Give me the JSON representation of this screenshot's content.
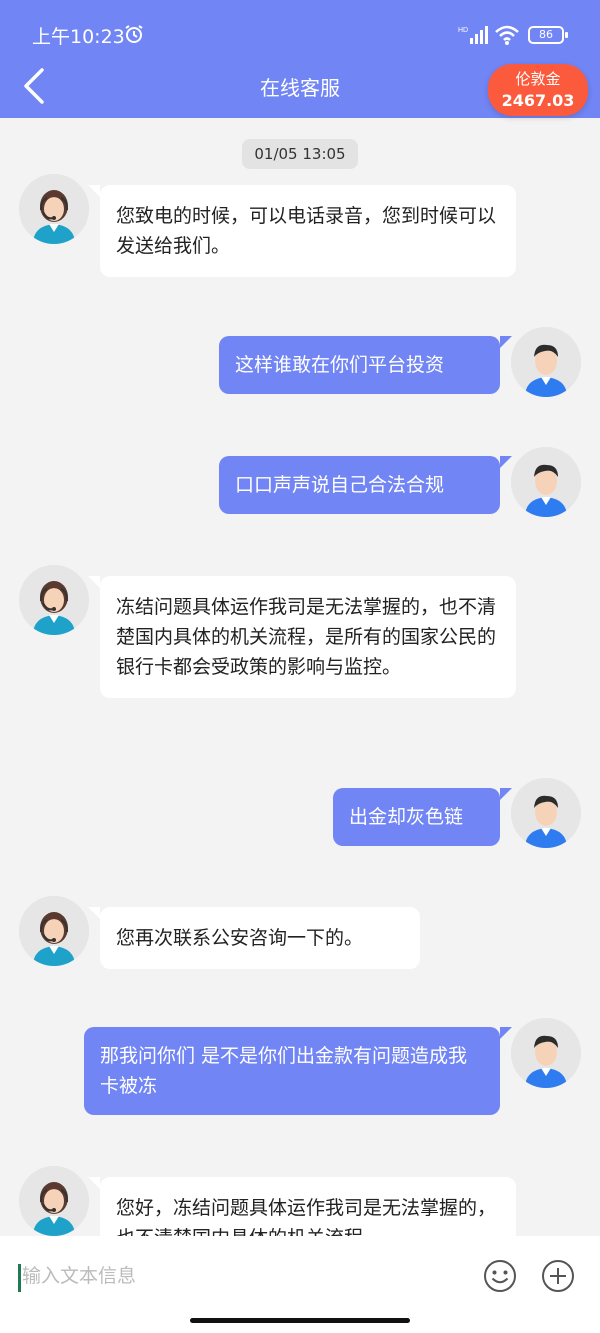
{
  "status_bar": {
    "time": "上午10:23",
    "battery": "86"
  },
  "header": {
    "title": "在线客服",
    "balance_label": "伦敦金",
    "balance_value": "2467.03"
  },
  "timestamp": "01/05 13:05",
  "messages": [
    {
      "side": "in",
      "text": "您致电的时候，可以电话录音，您到时候可以发送给我们。"
    },
    {
      "side": "out",
      "text": "这样谁敢在你们平台投资"
    },
    {
      "side": "out",
      "text": "口口声声说自己合法合规"
    },
    {
      "side": "in",
      "text": "冻结问题具体运作我司是无法掌握的，也不清楚国内具体的机关流程，是所有的国家公民的银行卡都会受政策的影响与监控。"
    },
    {
      "side": "out",
      "text": "出金却灰色链"
    },
    {
      "side": "in",
      "text": "您再次联系公安咨询一下的。"
    },
    {
      "side": "out",
      "text": "那我问你们 是不是你们出金款有问题造成我卡被冻"
    },
    {
      "side": "in",
      "text": "您好，冻结问题具体运作我司是无法掌握的，也不清楚国内具体的机关流程"
    }
  ],
  "composer": {
    "placeholder": "输入文本信息"
  },
  "icons": {
    "alarm": "alarm-icon",
    "signal": "signal-icon",
    "wifi": "wifi-icon",
    "back": "chevron-left-icon",
    "emoji": "smile-icon",
    "add": "plus-circle-icon"
  },
  "colors": {
    "header": "#7185f5",
    "out_bubble": "#7185f5",
    "balance_badge": "#fb5a3c",
    "background": "#f3f3f3"
  }
}
